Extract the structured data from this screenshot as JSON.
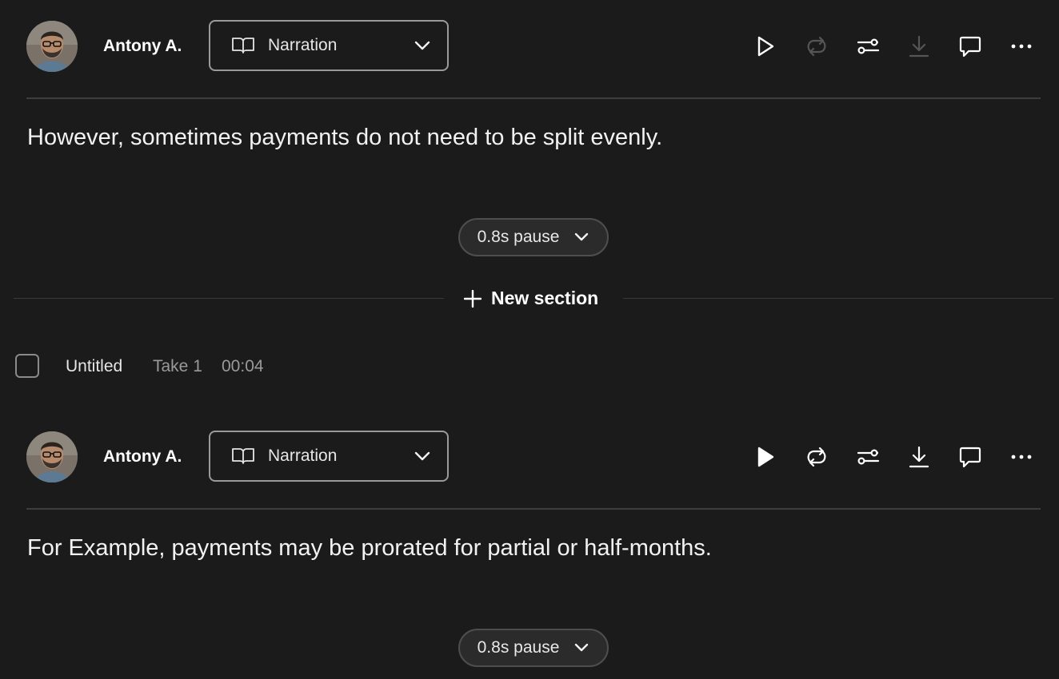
{
  "blocks": [
    {
      "speaker": {
        "name": "Antony A.",
        "avatar": "avatar-icon"
      },
      "style_select": {
        "label": "Narration",
        "icon": "book-icon"
      },
      "toolbar": {
        "icons": [
          "play-icon",
          "regenerate-icon",
          "settings-sliders-icon",
          "download-icon",
          "comment-icon",
          "more-icon"
        ],
        "disabled": [
          "regenerate-icon",
          "download-icon"
        ]
      },
      "text": "However, sometimes payments do not need to be split evenly.",
      "pause": {
        "label": "0.8s pause"
      }
    },
    {
      "speaker": {
        "name": "Antony A.",
        "avatar": "avatar-icon"
      },
      "style_select": {
        "label": "Narration",
        "icon": "book-icon"
      },
      "toolbar": {
        "icons": [
          "play-icon",
          "regenerate-icon",
          "settings-sliders-icon",
          "download-icon",
          "comment-icon",
          "more-icon"
        ],
        "disabled": []
      },
      "text": "For Example, payments may be prorated for partial or half-months.",
      "pause": {
        "label": "0.8s pause"
      }
    }
  ],
  "new_section": {
    "label": "New section"
  },
  "section": {
    "title": "Untitled",
    "take": "Take 1",
    "duration": "00:04"
  },
  "colors": {
    "background": "#1b1b1b",
    "text": "#f2f2f2",
    "muted": "#9a9a9a",
    "disabled_icon": "#555555",
    "divider": "#3d3d3d"
  }
}
